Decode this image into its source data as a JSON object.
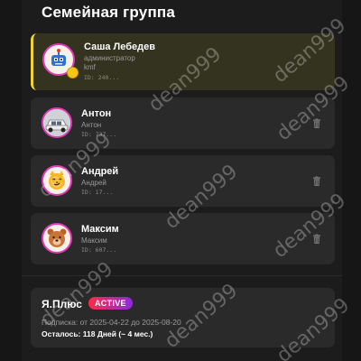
{
  "header": {
    "title": "Семейная группа"
  },
  "members": [
    {
      "name": "Саша Лебедев",
      "subtitle": "администратор",
      "extra": "kmf",
      "id_text": "ID: 240...",
      "avatar_icon": "robot-avatar-icon",
      "emoji": "🤖",
      "active": true,
      "deletable": false
    },
    {
      "name": "Антон",
      "subtitle": "Антон",
      "id_text": "ID: 737...",
      "avatar_icon": "car-avatar-icon",
      "emoji": "🚗",
      "active": false,
      "deletable": true
    },
    {
      "name": "Андрей",
      "subtitle": "Андрей",
      "id_text": "ID: 17...",
      "avatar_icon": "cat-avatar-icon",
      "emoji": "😼",
      "active": false,
      "deletable": true
    },
    {
      "name": "Максим",
      "subtitle": "Максим",
      "id_text": "ID: 607...",
      "avatar_icon": "bear-avatar-icon",
      "emoji": "🐻",
      "active": false,
      "deletable": true
    }
  ],
  "plus": {
    "title": "Я.Плюс",
    "status": "ACTIVE",
    "subscription": "Подписка: от 2025-04-22 до 2025-08-20",
    "remaining": "Осталось: 118 Дней (~ 4 мес.)"
  },
  "watermark": "dean999",
  "colors": {
    "background": "#1c1c1c",
    "card": "#2a2a2a",
    "active_card": "#34331f",
    "active_accent": "#f2d230",
    "avatar_border": "#e23ab7",
    "badge_gradient_start": "#ff2a44",
    "badge_gradient_end": "#8b2bdf"
  }
}
